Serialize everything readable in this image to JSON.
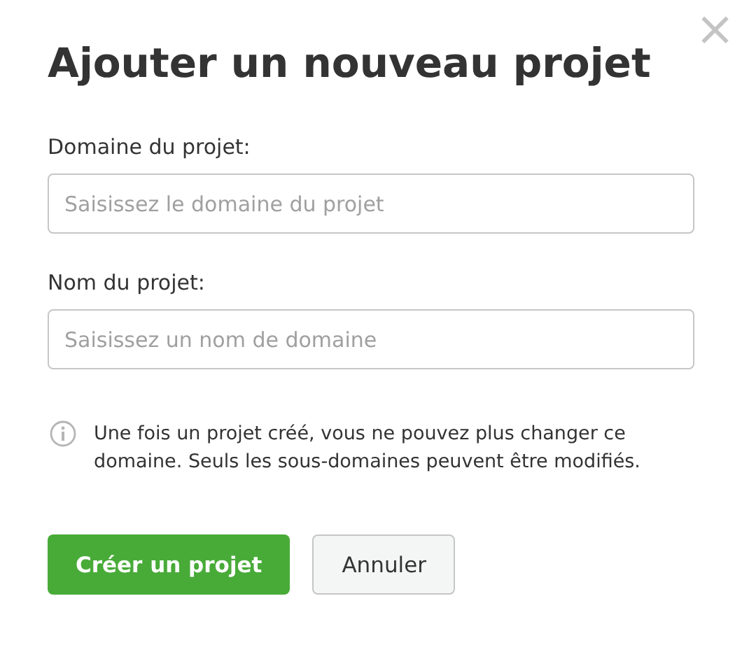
{
  "dialog": {
    "title": "Ajouter un nouveau projet",
    "close": "×"
  },
  "fields": [
    {
      "label": "Domaine du projet:",
      "placeholder": "Saisissez le domaine du projet"
    },
    {
      "label": "Nom du projet:",
      "placeholder": "Saisissez un nom de domaine"
    }
  ],
  "note": "Une fois un projet créé, vous ne pouvez plus changer ce domaine. Seuls les sous-domaines peuvent être modifiés.",
  "buttons": [
    {
      "label": "Créer un projet",
      "kind": "primary"
    },
    {
      "label": "Annuler",
      "kind": "secondary"
    }
  ]
}
